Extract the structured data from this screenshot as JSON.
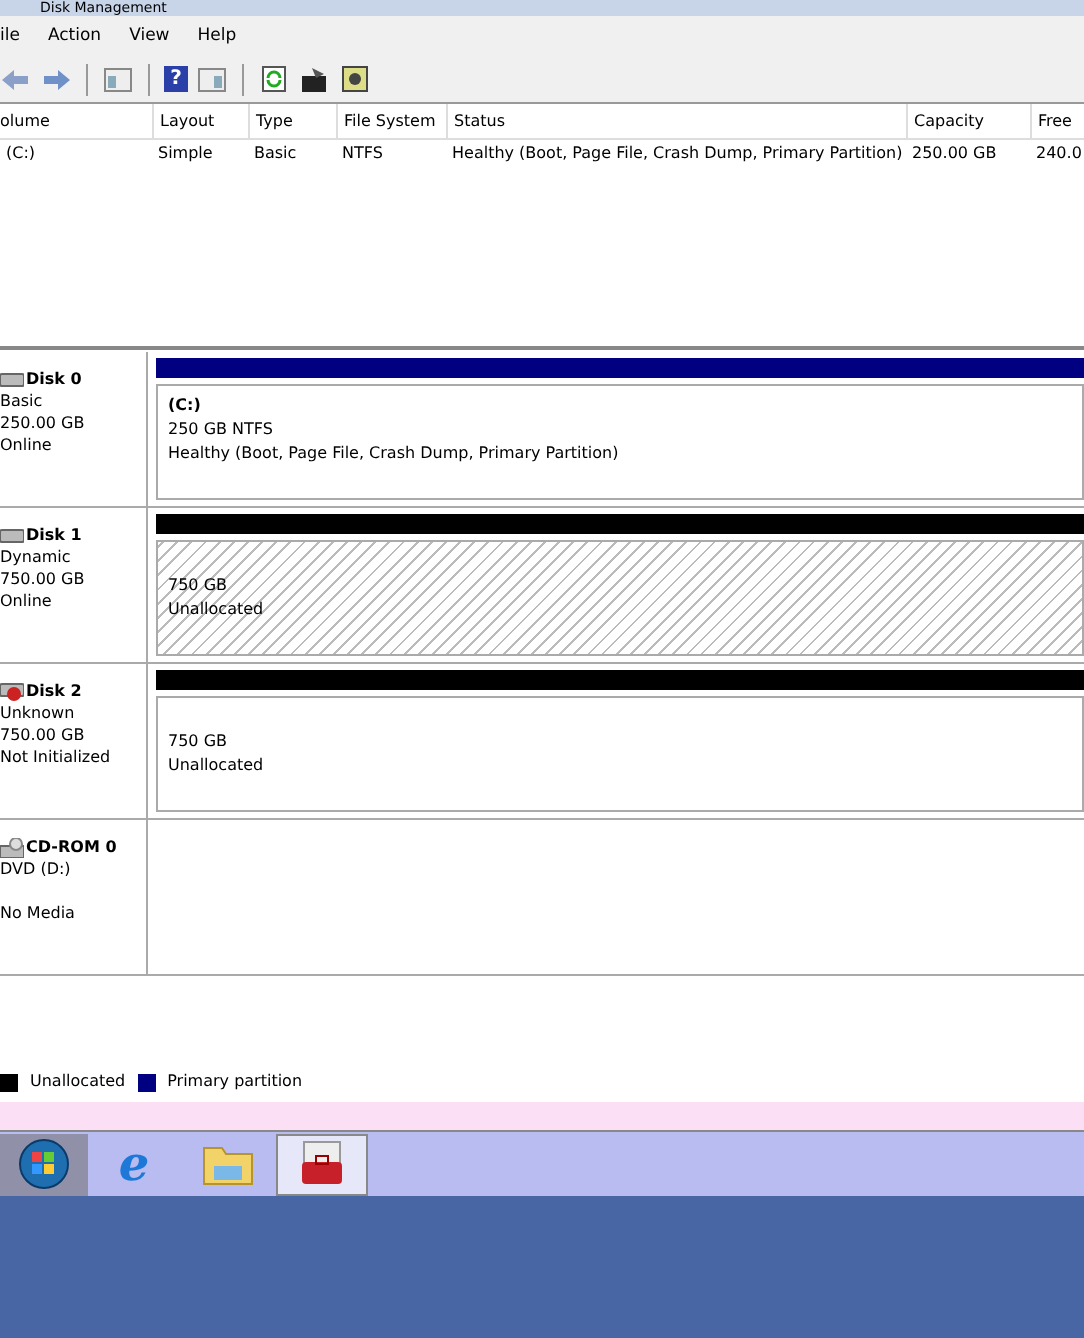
{
  "window": {
    "title": "Disk Management"
  },
  "menu": [
    "ile",
    "Action",
    "View",
    "Help"
  ],
  "toolbar": [
    {
      "kind": "back"
    },
    {
      "kind": "forward"
    },
    {
      "kind": "console"
    },
    {
      "kind": "help",
      "glyph": "?"
    },
    {
      "kind": "view"
    },
    {
      "kind": "refresh"
    },
    {
      "kind": "properties"
    },
    {
      "kind": "settings"
    }
  ],
  "volume_list": {
    "columns": [
      "olume",
      "Layout",
      "Type",
      "File System",
      "Status",
      "Capacity",
      "Free"
    ],
    "rows": [
      [
        "(C:)",
        "Simple",
        "Basic",
        "NTFS",
        "Healthy (Boot, Page File, Crash Dump, Primary Partition)",
        "250.00 GB",
        "240.0"
      ]
    ]
  },
  "disks": [
    {
      "kind": "disk",
      "name": "Disk 0",
      "type": "Basic",
      "size": "250.00 GB",
      "status": "Online",
      "partition": {
        "kind": "primary",
        "hatched": false,
        "label": "(C:)",
        "size": "250 GB NTFS",
        "status": "Healthy (Boot, Page File, Crash Dump, Primary Partition)"
      }
    },
    {
      "kind": "disk",
      "name": "Disk 1",
      "type": "Dynamic",
      "size": "750.00 GB",
      "status": "Online",
      "partition": {
        "kind": "unallocated",
        "hatched": true,
        "size": "750 GB",
        "status": "Unallocated"
      }
    },
    {
      "kind": "disk_error",
      "name": "Disk 2",
      "type": "Unknown",
      "size": "750.00 GB",
      "status": "Not Initialized",
      "partition": {
        "kind": "unallocated",
        "hatched": false,
        "size": "750 GB",
        "status": "Unallocated"
      }
    },
    {
      "kind": "cdrom",
      "name": "CD-ROM 0",
      "type": "DVD (D:)",
      "status": "No Media"
    }
  ],
  "legend": [
    {
      "label": "Unallocated",
      "color": "#000000"
    },
    {
      "label": "Primary partition",
      "color": "#000080"
    }
  ],
  "taskbar": [
    {
      "kind": "start",
      "selected": false
    },
    {
      "kind": "browser",
      "glyph": "e",
      "selected": false
    },
    {
      "kind": "folder",
      "selected": false
    },
    {
      "kind": "toolbox",
      "selected": true
    }
  ]
}
